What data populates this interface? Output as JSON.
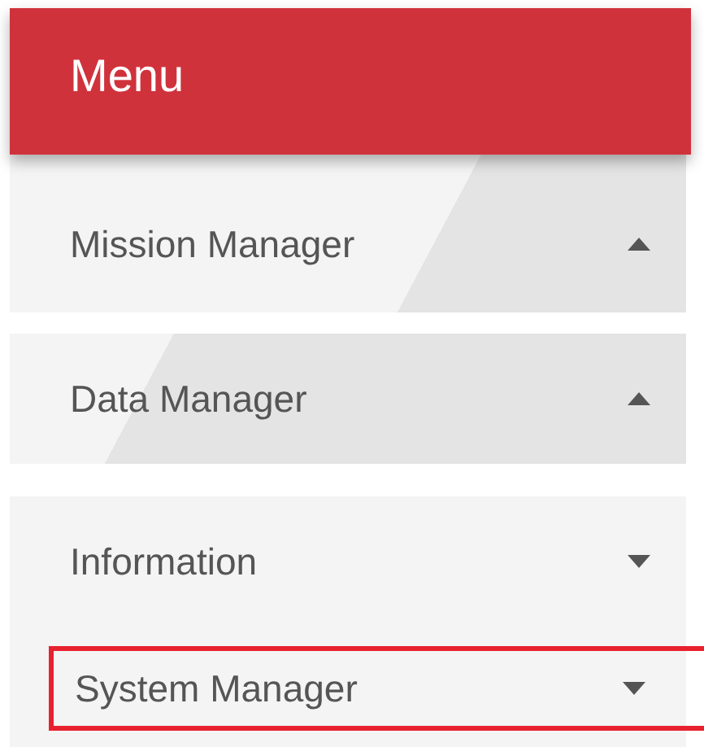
{
  "header": {
    "title": "Menu"
  },
  "items": [
    {
      "label": "Mission Manager",
      "expanded": true
    },
    {
      "label": "Data Manager",
      "expanded": true
    },
    {
      "label": "Information",
      "expanded": false,
      "children": [
        {
          "label": "System Manager",
          "expanded": false,
          "selected": true
        }
      ]
    }
  ]
}
